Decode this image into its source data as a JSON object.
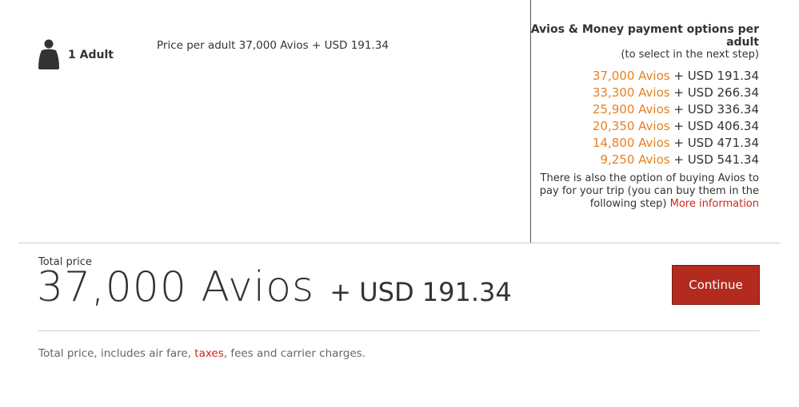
{
  "passenger": {
    "label": "1 Adult",
    "icon": "person-icon"
  },
  "price_per_adult": "Price per adult 37,000 Avios + USD 191.34",
  "payment_options": {
    "title": "Avios & Money payment options per adult",
    "subtitle": "(to select in the next step)",
    "options": [
      {
        "avios": "37,000 Avios",
        "money": "+ USD 191.34"
      },
      {
        "avios": "33,300 Avios",
        "money": "+ USD 266.34"
      },
      {
        "avios": "25,900 Avios",
        "money": "+ USD 336.34"
      },
      {
        "avios": "20,350 Avios",
        "money": "+ USD 406.34"
      },
      {
        "avios": "14,800 Avios",
        "money": "+ USD 471.34"
      },
      {
        "avios": "9,250 Avios",
        "money": "+ USD 541.34"
      }
    ],
    "note": "There is also the option of buying Avios to pay for your trip (you can buy them in the following step)",
    "more_info_link": "More information"
  },
  "total": {
    "label": "Total price",
    "avios": "37,000 Avios",
    "money": "+ USD 191.34"
  },
  "continue_label": "Continue",
  "footnote": {
    "before": "Total price, includes air fare, ",
    "taxes_link": "taxes",
    "after": ", fees and carrier charges."
  },
  "colors": {
    "avios_accent": "#e6801f",
    "link": "#c8281e",
    "button": "#b32b1e"
  }
}
